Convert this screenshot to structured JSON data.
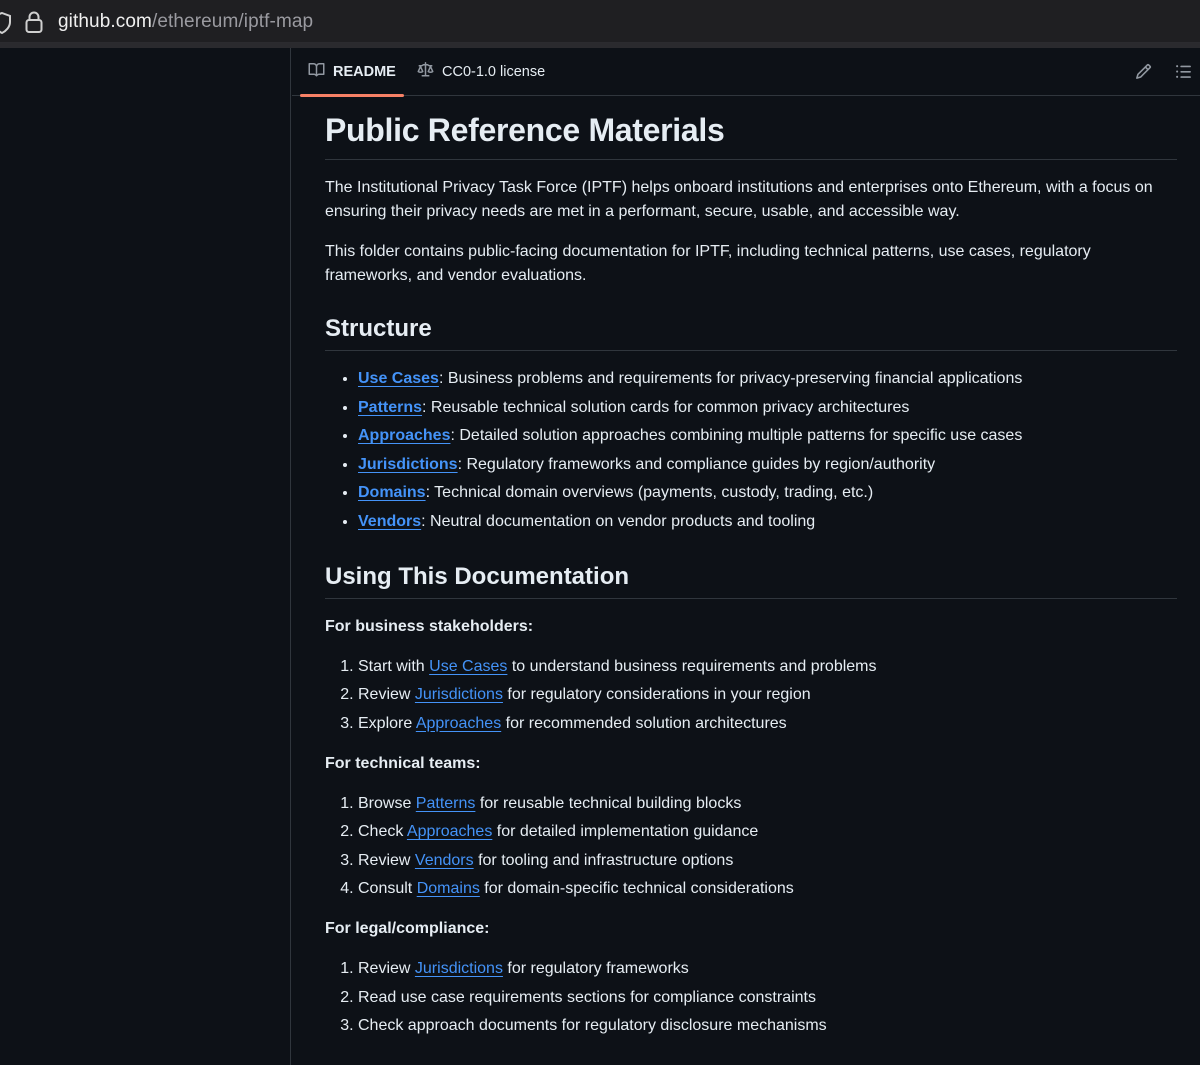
{
  "browser": {
    "url_host": "github.com",
    "url_path": "/ethereum/iptf-map"
  },
  "tabs": {
    "readme_label": "README",
    "license_label": "CC0-1.0 license"
  },
  "icons": {
    "readme": "book-icon",
    "license": "scale-icon",
    "edit": "pencil-icon",
    "toc": "list-unordered-icon"
  },
  "colors": {
    "link": "#4493f8",
    "active_tab_underline": "#f78166",
    "background": "#0d1117",
    "text": "#e6edf3"
  },
  "article": {
    "title": "Public Reference Materials",
    "intro_1": "The Institutional Privacy Task Force (IPTF) helps onboard institutions and enterprises onto Ethereum, with a focus on ensuring their privacy needs are met in a performant, secure, usable, and accessible way.",
    "intro_2": "This folder contains public-facing documentation for IPTF, including technical patterns, use cases, regulatory frameworks, and vendor evaluations.",
    "structure_heading": "Structure",
    "structure_items": [
      {
        "link": "Use Cases",
        "text": ": Business problems and requirements for privacy-preserving financial applications"
      },
      {
        "link": "Patterns",
        "text": ": Reusable technical solution cards for common privacy architectures"
      },
      {
        "link": "Approaches",
        "text": ": Detailed solution approaches combining multiple patterns for specific use cases"
      },
      {
        "link": "Jurisdictions",
        "text": ": Regulatory frameworks and compliance guides by region/authority"
      },
      {
        "link": "Domains",
        "text": ": Technical domain overviews (payments, custody, trading, etc.)"
      },
      {
        "link": "Vendors",
        "text": ": Neutral documentation on vendor products and tooling"
      }
    ],
    "using_heading": "Using This Documentation",
    "business_heading": "For business stakeholders:",
    "business_items": [
      {
        "pre": "Start with ",
        "link": "Use Cases",
        "post": " to understand business requirements and problems"
      },
      {
        "pre": "Review ",
        "link": "Jurisdictions",
        "post": " for regulatory considerations in your region"
      },
      {
        "pre": "Explore ",
        "link": "Approaches",
        "post": " for recommended solution architectures"
      }
    ],
    "technical_heading": "For technical teams:",
    "technical_items": [
      {
        "pre": "Browse ",
        "link": "Patterns",
        "post": " for reusable technical building blocks"
      },
      {
        "pre": "Check ",
        "link": "Approaches",
        "post": " for detailed implementation guidance"
      },
      {
        "pre": "Review ",
        "link": "Vendors",
        "post": " for tooling and infrastructure options"
      },
      {
        "pre": "Consult ",
        "link": "Domains",
        "post": " for domain-specific technical considerations"
      }
    ],
    "legal_heading": "For legal/compliance:",
    "legal_items": [
      {
        "pre": "Review ",
        "link": "Jurisdictions",
        "post": " for regulatory frameworks"
      },
      {
        "pre": "Read use case requirements sections for compliance constraints",
        "link": "",
        "post": ""
      },
      {
        "pre": "Check approach documents for regulatory disclosure mechanisms",
        "link": "",
        "post": ""
      }
    ]
  }
}
